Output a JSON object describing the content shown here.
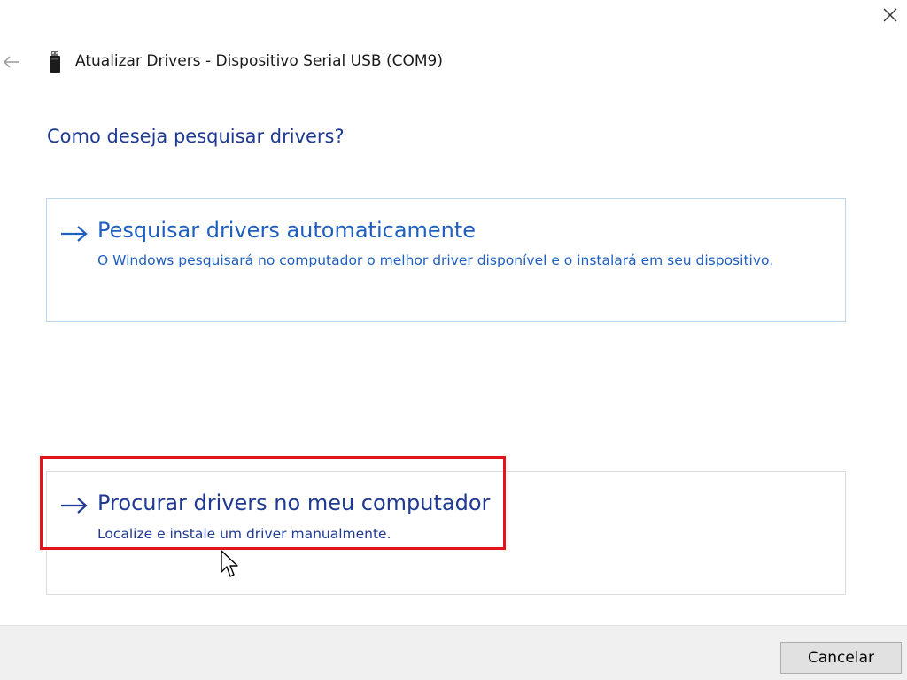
{
  "window": {
    "close_icon": "close-icon",
    "back_icon": "back-arrow-icon"
  },
  "header": {
    "device_icon": "usb-serial-device-icon",
    "title": "Atualizar Drivers - Dispositivo Serial USB (COM9)"
  },
  "main": {
    "question": "Como deseja pesquisar drivers?",
    "options": [
      {
        "icon": "arrow-right-icon",
        "title": "Pesquisar drivers automaticamente",
        "description": "O Windows pesquisará no computador o melhor driver disponível e o instalará em seu dispositivo."
      },
      {
        "icon": "arrow-right-icon",
        "title": "Procurar drivers no meu computador",
        "description": "Localize e instale um driver manualmente.",
        "highlighted": true
      }
    ]
  },
  "footer": {
    "cancel_label": "Cancelar"
  },
  "colors": {
    "link_blue": "#1f5fbf",
    "dark_blue": "#1f3a93",
    "highlight_red": "#e5141c",
    "option_border": "#bcd6ee",
    "footer_bg": "#f0f0f0"
  }
}
